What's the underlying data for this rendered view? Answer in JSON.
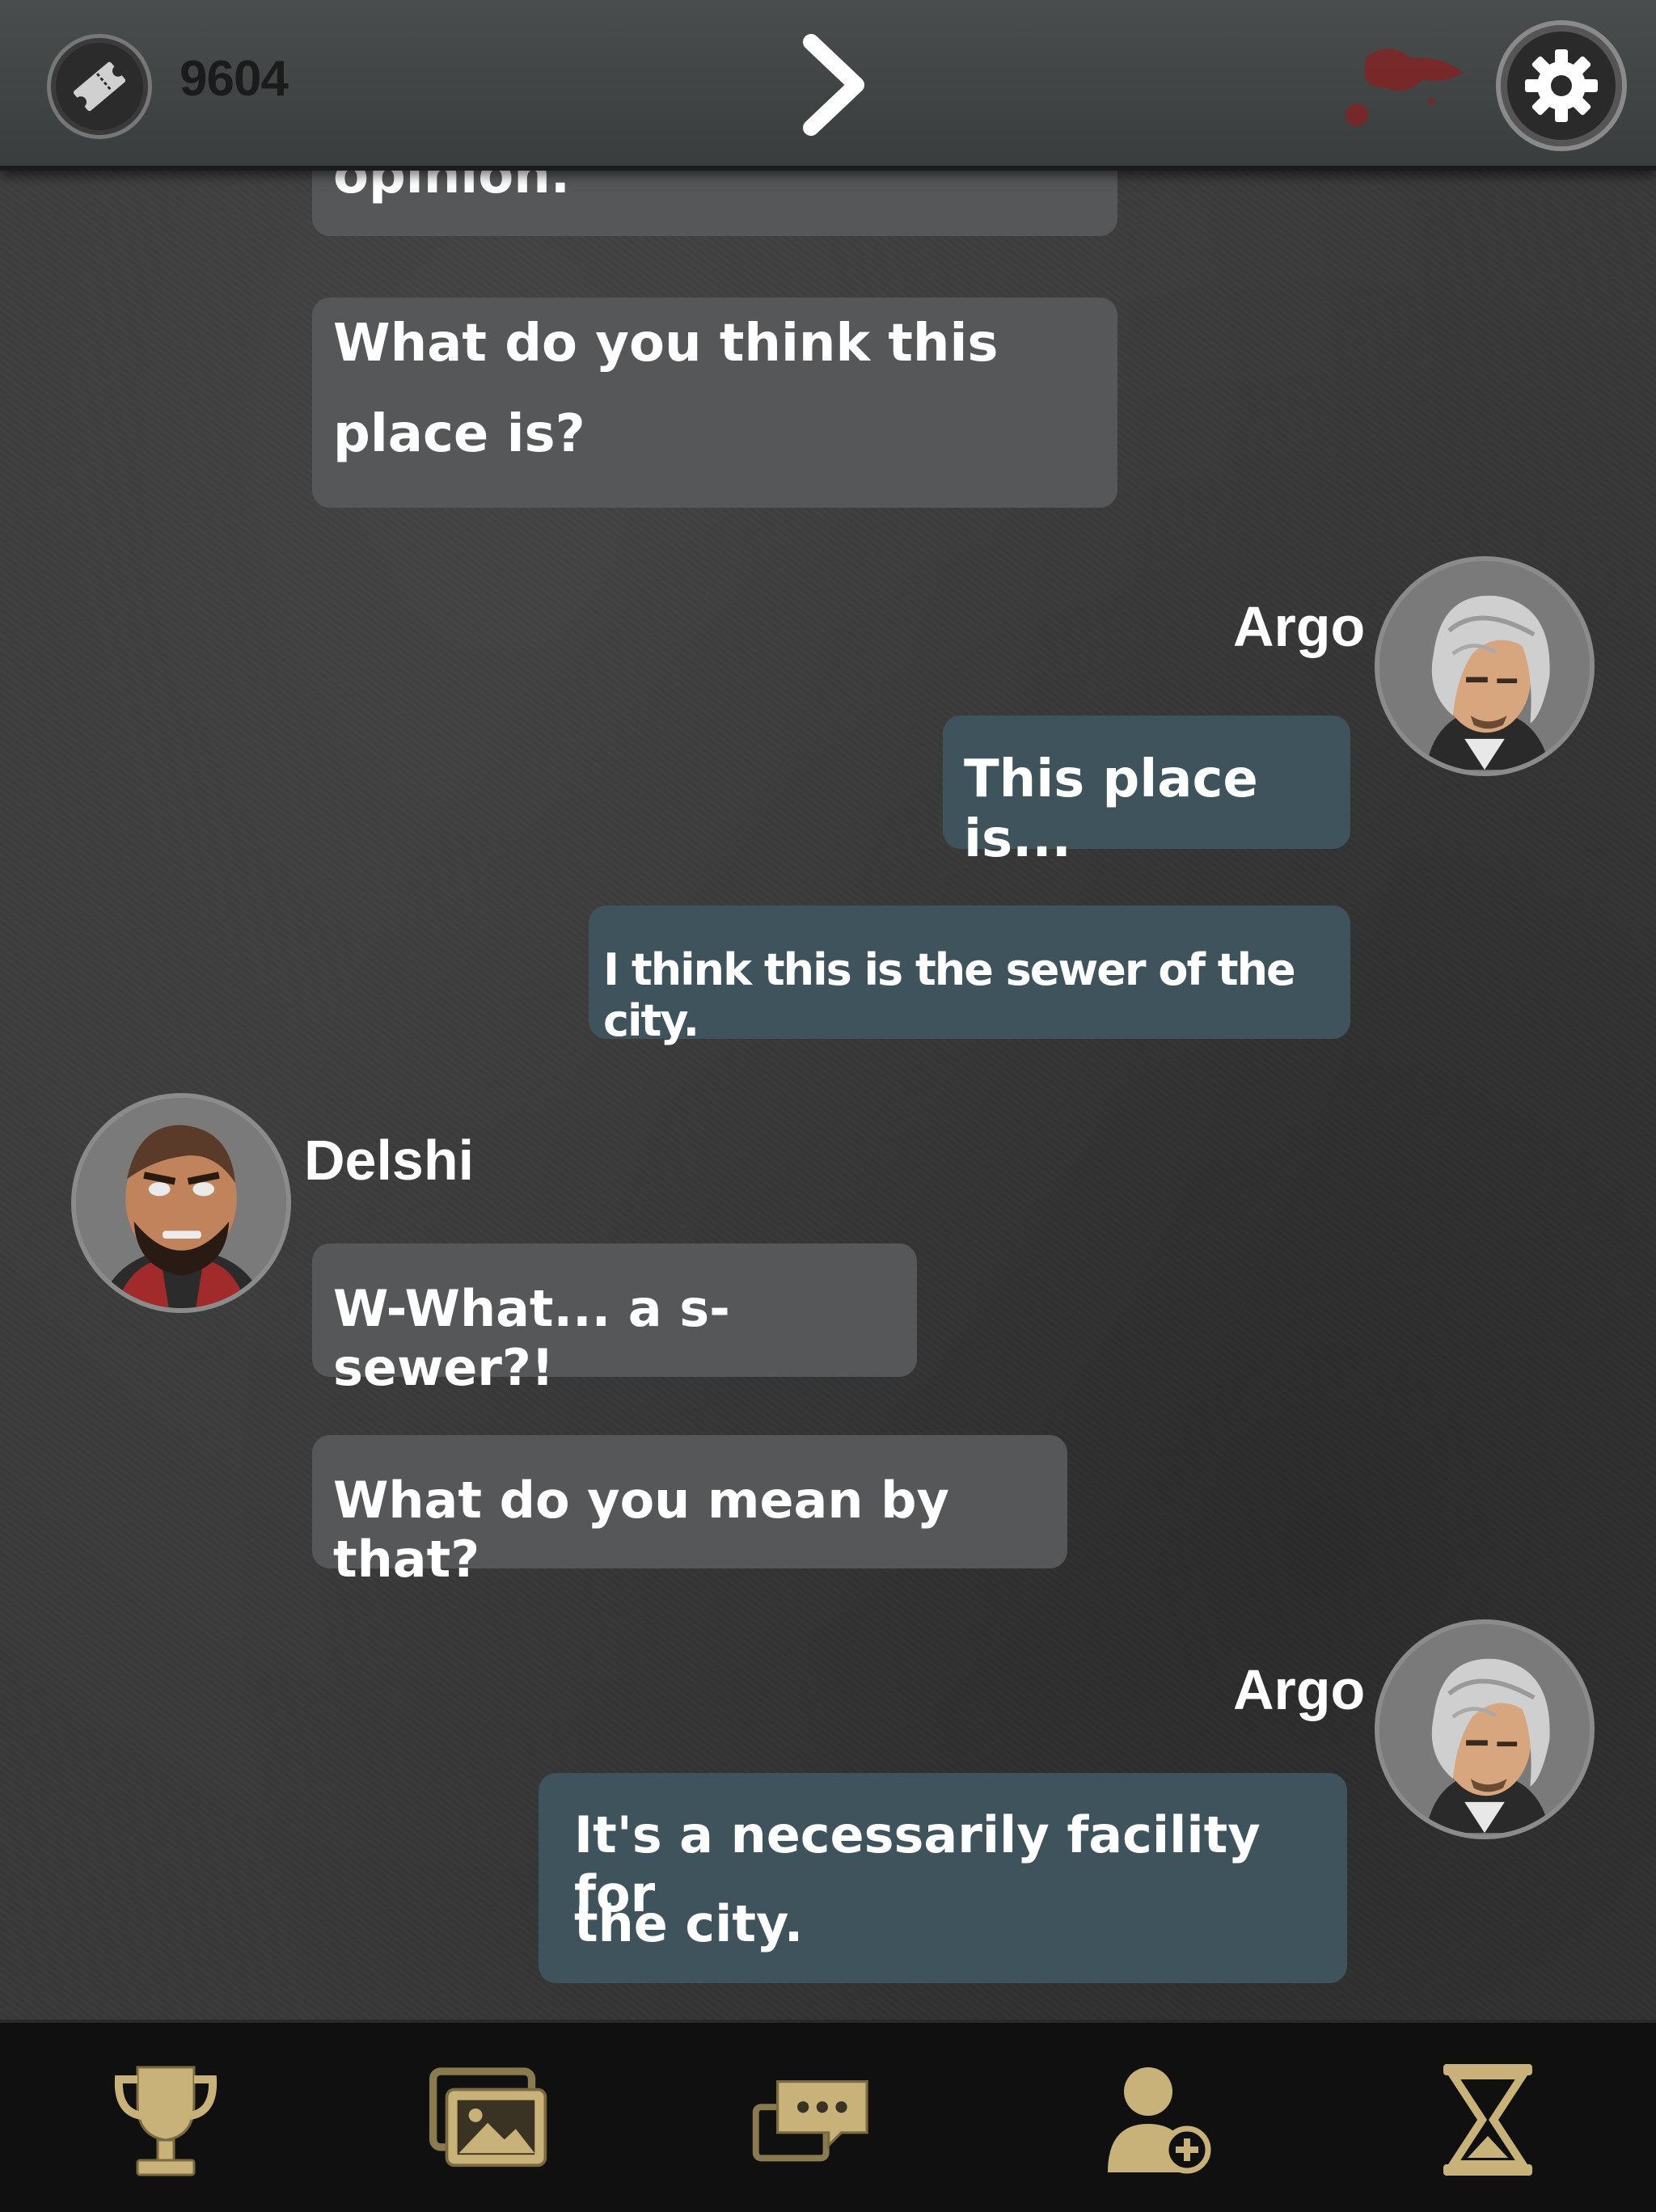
{
  "header": {
    "ticket_count": "9604",
    "ticket_icon": "ticket-icon",
    "next_icon": "chevron-right-icon",
    "settings_icon": "gear-icon"
  },
  "chat": {
    "partial_message": "opinion.",
    "messages": [
      {
        "speaker": "",
        "line1": "What do you think this",
        "line2": "place is?"
      },
      {
        "speaker": "Argo",
        "text": "This place is..."
      },
      {
        "speaker": "Argo",
        "text": "I think this is the sewer of the city."
      },
      {
        "speaker": "Delshi",
        "text": "W-What... a s-sewer?!"
      },
      {
        "speaker": "Delshi",
        "text": "What do you mean by that?"
      },
      {
        "speaker": "Argo",
        "line1": "It's a necessarily facility for",
        "line2": "the city."
      }
    ],
    "names": {
      "argo": "Argo",
      "delshi": "Delshi"
    }
  },
  "bottom_nav": {
    "items": [
      "trophy-icon",
      "gallery-icon",
      "chat-icon",
      "add-contact-icon",
      "hourglass-icon"
    ],
    "icon_color": "#c9b27a"
  },
  "colors": {
    "npc_bubble": "#555759",
    "player_bubble": "#3f535d",
    "background": "#393939"
  }
}
